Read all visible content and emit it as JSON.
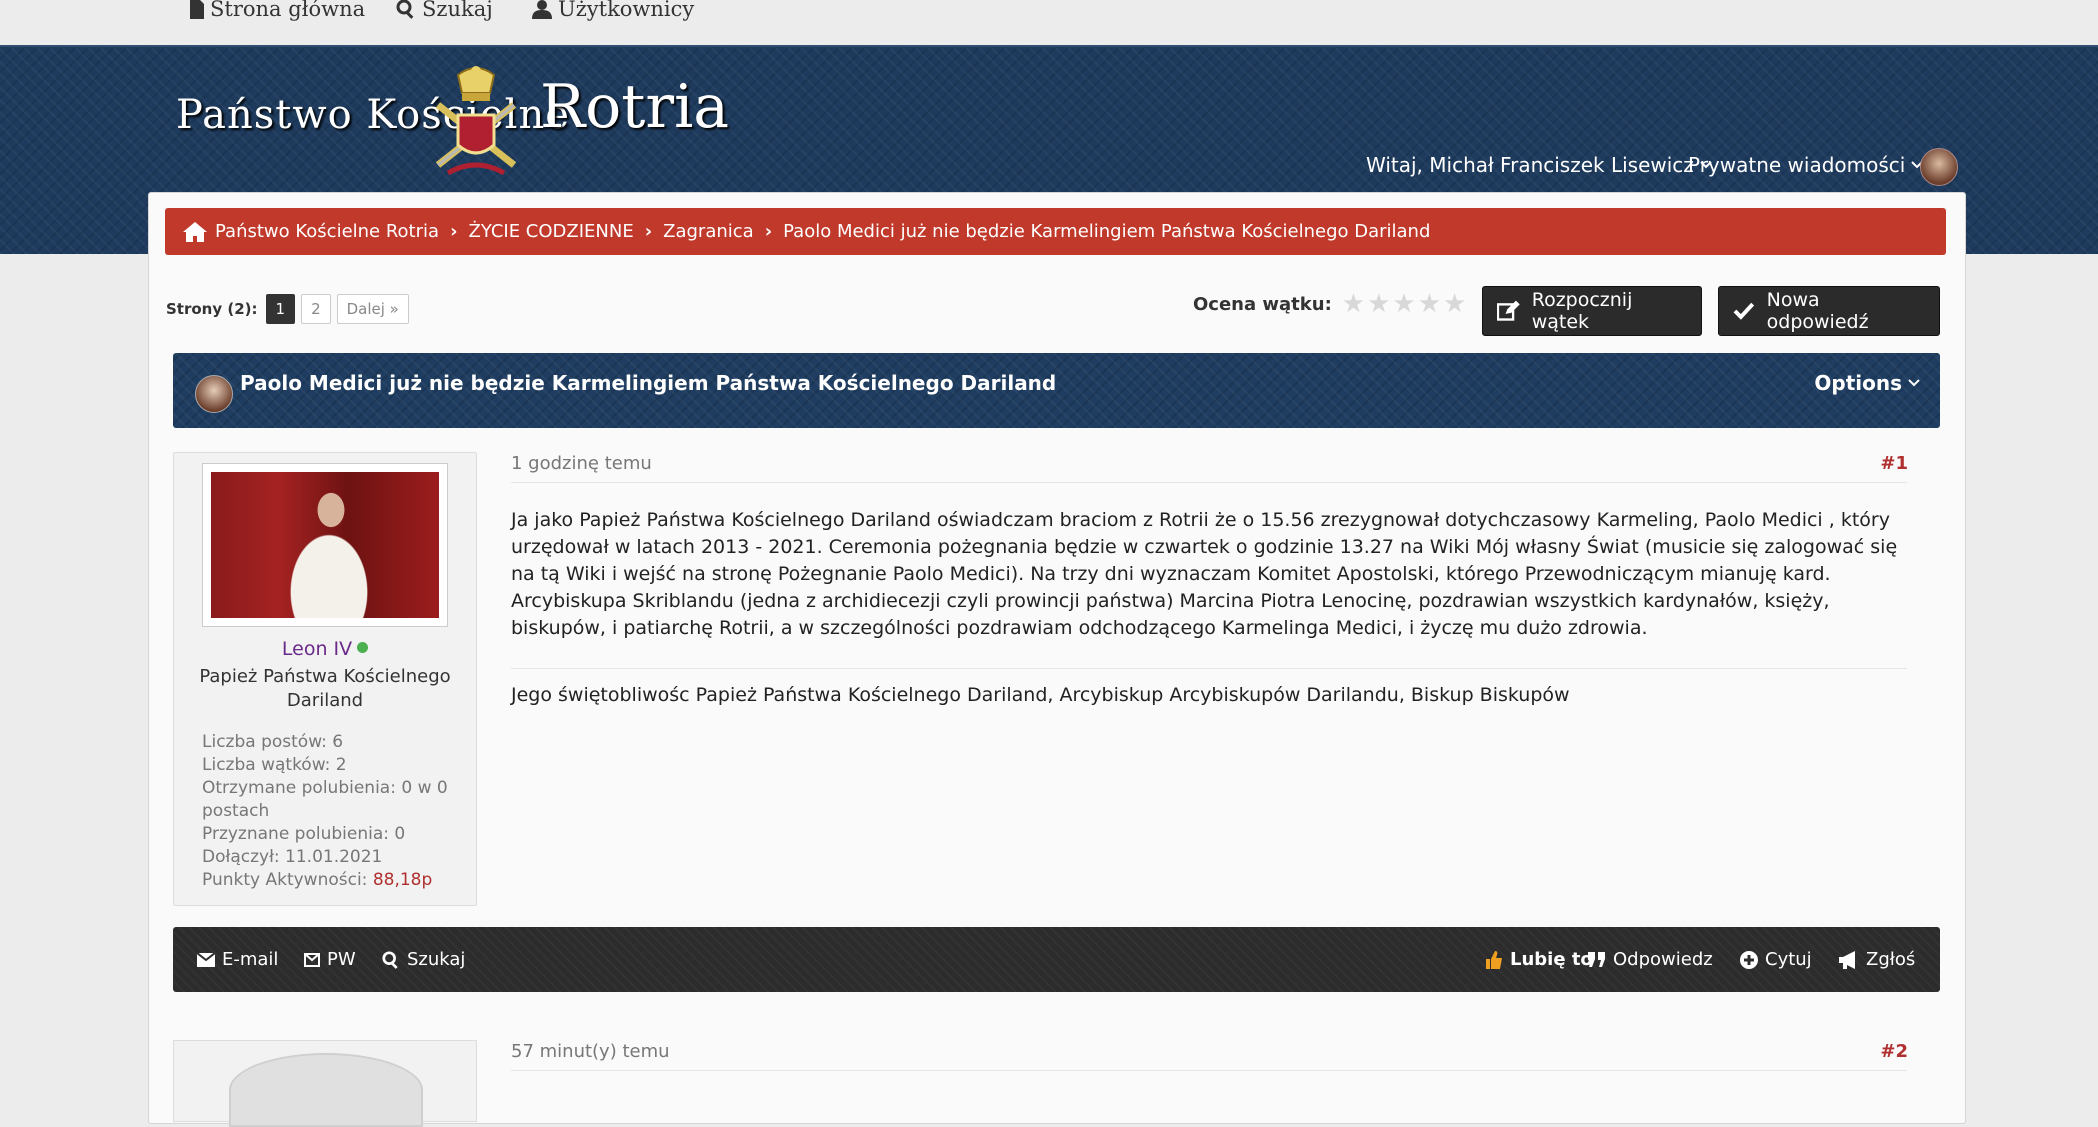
{
  "topnav": {
    "home": "Strona główna",
    "search": "Szukaj",
    "users": "Użytkownicy"
  },
  "header": {
    "logo_left": "Państwo Kościelne",
    "logo_right": "Rotria",
    "welcome": "Witaj, Michał Franciszek Lisewicz",
    "private_messages": "Prywatne wiadomości"
  },
  "breadcrumb": {
    "items": [
      "Państwo Kościelne Rotria",
      "ŻYCIE CODZIENNE",
      "Zagranica",
      "Paolo Medici już nie będzie Karmelingiem Państwa Kościelnego Dariland"
    ]
  },
  "pagination": {
    "label": "Strony (2):",
    "pages": [
      "1",
      "2"
    ],
    "current": "1",
    "next": "Dalej »"
  },
  "rating": {
    "label": "Ocena wątku:",
    "value": 0,
    "max": 5
  },
  "buttons": {
    "new_thread": "Rozpocznij wątek",
    "new_reply": "Nowa odpowiedź"
  },
  "thread": {
    "title": "Paolo Medici już nie będzie Karmelingiem Państwa Kościelnego Dariland",
    "options": "Options"
  },
  "post1": {
    "author": "Leon IV",
    "user_title": "Papież Państwa Kościelnego Dariland",
    "stats": {
      "posts": "Liczba postów: 6",
      "threads": "Liczba wątków: 2",
      "likes_received": "Otrzymane polubienia: 0 w 0 postach",
      "likes_given": "Przyznane polubienia: 0",
      "joined": "Dołączył: 11.01.2021",
      "activity_label": "Punkty Aktywności:",
      "activity_value": "88,18p"
    },
    "time": "1 godzinę temu",
    "number": "#1",
    "body": "Ja jako Papież Państwa Kościelnego Dariland oświadczam braciom z Rotrii że o 15.56 zrezygnował dotychczasowy Karmeling, Paolo Medici , który urzędował w latach 2013 - 2021. Ceremonia pożegnania będzie w czwartek o godzinie 13.27 na Wiki Mój własny Świat (musicie się zalogować się na tą Wiki i wejść na stronę Pożegnanie Paolo Medici). Na trzy dni wyznaczam Komitet Apostolski, którego Przewodniczącym mianuję kard. Arcybiskupa Skriblandu (jedna z archidiecezji czyli prowincji państwa) Marcina Piotra Lenocinę, pozdrawian wszystkich kardynałów, księży, biskupów, i patiarchę Rotrii, a w szczególności pozdrawiam odchodzącego Karmelinga Medici, i życzę mu dużo zdrowia.",
    "signature": "Jego świętobliwośc Papież Państwa Kościelnego Dariland, Arcybiskup Arcybiskupów Darilandu, Biskup Biskupów"
  },
  "post_actions": {
    "email": "E-mail",
    "pm": "PW",
    "search": "Szukaj",
    "like": "Lubię to",
    "reply": "Odpowiedz",
    "quote": "Cytuj",
    "report": "Zgłoś"
  },
  "post2": {
    "time": "57 minut(y) temu",
    "number": "#2"
  }
}
